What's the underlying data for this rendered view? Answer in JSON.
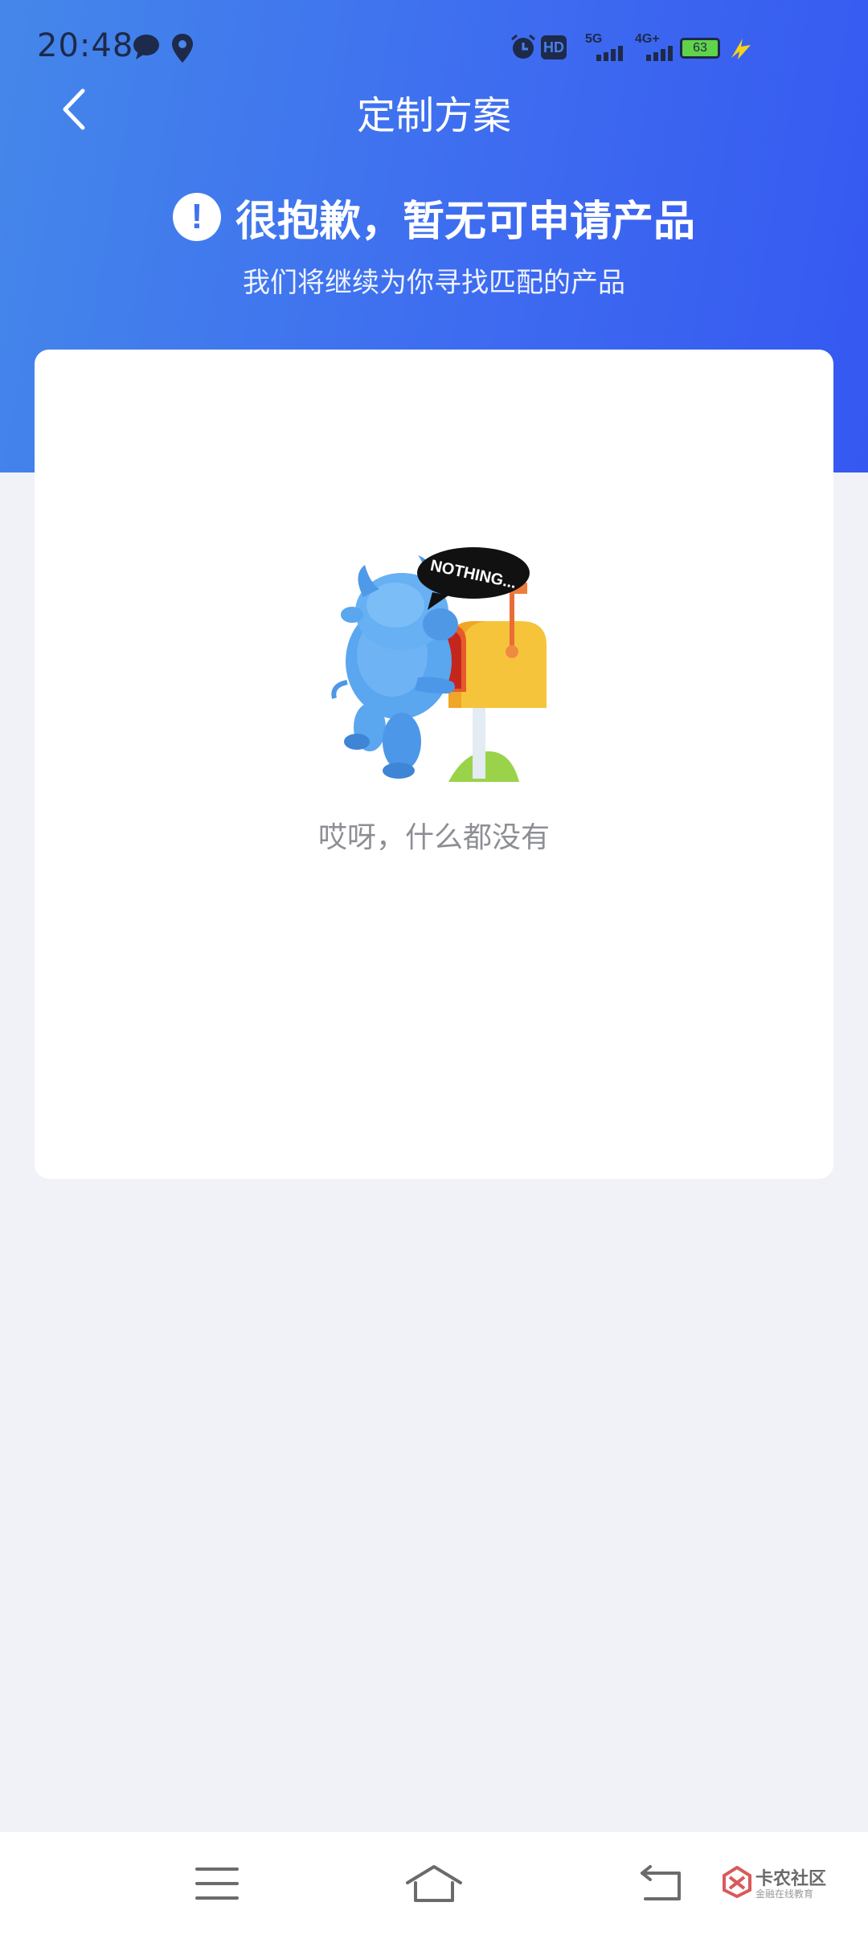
{
  "status_bar": {
    "time": "20:48",
    "network_5g": "5G",
    "network_4g": "4G+",
    "hd_label": "HD",
    "battery": "63"
  },
  "header": {
    "title": "定制方案",
    "back_icon": "chevron-left-icon"
  },
  "notice": {
    "icon": "exclamation-circle-icon",
    "title": "很抱歉，暂无可申请产品",
    "subtitle": "我们将继续为你寻找匹配的产品"
  },
  "empty_state": {
    "bubble_text": "NOTHING...",
    "message": "哎呀，什么都没有"
  },
  "nav_bar": {
    "menu_icon": "menu-icon",
    "home_icon": "home-icon",
    "back_icon": "back-arrow-icon"
  },
  "watermark": {
    "name": "卡农社区",
    "tagline": "金融在线教育"
  },
  "colors": {
    "hero_start": "#4487ea",
    "hero_end": "#3558f1",
    "background": "#f0f2f7",
    "card": "#ffffff",
    "empty_text": "#8d8f95"
  }
}
